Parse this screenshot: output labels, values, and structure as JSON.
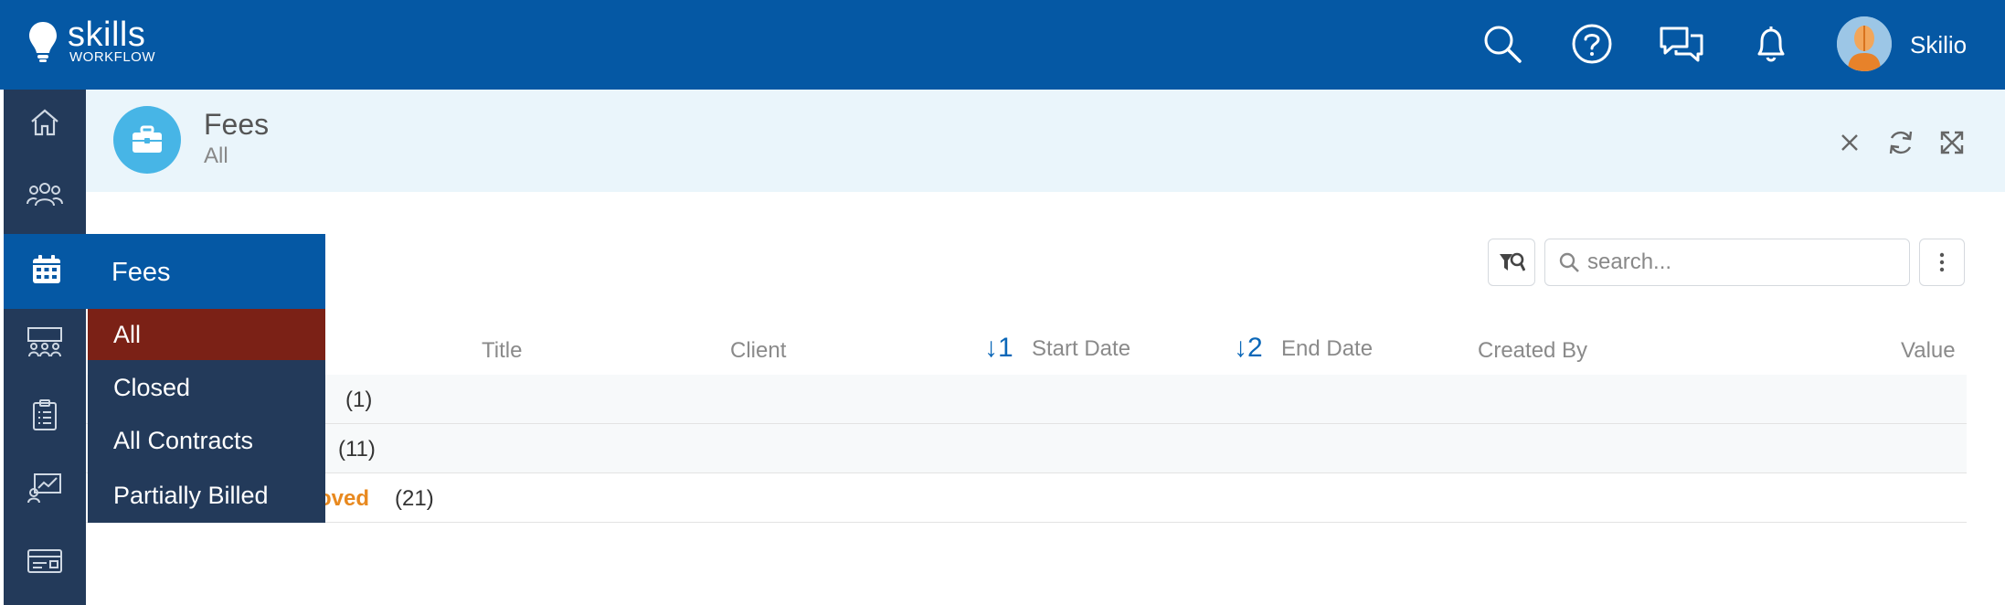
{
  "app": {
    "logo_name": "skills",
    "logo_sub": "WORKFLOW",
    "username": "Skilio"
  },
  "topbar_icons": [
    "search-icon",
    "help-icon",
    "chat-icon",
    "bell-icon"
  ],
  "sidebar": {
    "items": [
      "home-icon",
      "people-icon",
      "calendar-icon",
      "team-icon",
      "clipboard-icon",
      "chart-icon",
      "card-icon"
    ],
    "active": "calendar-icon"
  },
  "header": {
    "title": "Fees",
    "subtitle": "All"
  },
  "toolbar": {
    "search_placeholder": "search..."
  },
  "table": {
    "columns": {
      "title": "Title",
      "client": "Client",
      "start_sort": "↓1",
      "start_date": "Start Date",
      "end_sort": "↓2",
      "end_date": "End Date",
      "created_by": "Created By",
      "value": "Value"
    },
    "rows": [
      {
        "label": "",
        "count": "(1)"
      },
      {
        "label": "",
        "count": "(11)"
      },
      {
        "label": "oved",
        "count": "(21)"
      }
    ]
  },
  "fees_menu": {
    "title": "Fees",
    "items": [
      "All",
      "Closed",
      "All Contracts",
      "Partially Billed"
    ],
    "selected": "All"
  },
  "colors": {
    "topbar": "#0558a4",
    "sidebar": "#233a5a",
    "selected_item": "#7b2116",
    "header_bg": "#eaf5fb",
    "accent_orange": "#e8891f"
  }
}
